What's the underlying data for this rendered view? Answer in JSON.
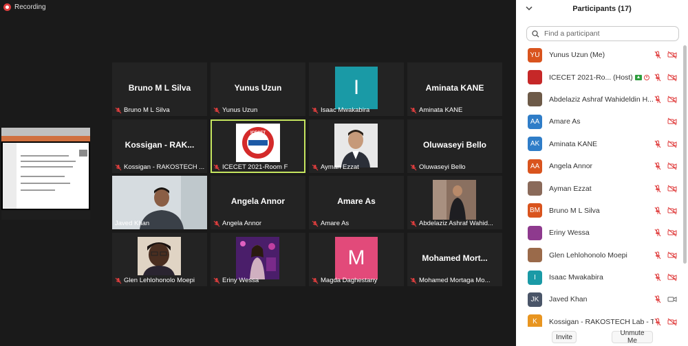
{
  "recording": {
    "label": "Recording"
  },
  "tiles": [
    {
      "id": "t1",
      "big": "Bruno M L Silva",
      "label": "Bruno M L Silva"
    },
    {
      "id": "t2",
      "big": "Yunus Uzun",
      "label": "Yunus Uzun"
    },
    {
      "id": "t3",
      "letter": "I",
      "label": "Isaac Mwakabira"
    },
    {
      "id": "t4",
      "big": "Aminata KANE",
      "label": "Aminata KANE"
    },
    {
      "id": "t5",
      "big": "Kossigan  - RAK...",
      "label": "Kossigan - RAKOSTECH ..."
    },
    {
      "id": "t6",
      "logo": "ICECET",
      "label": "ICECET 2021-Room F"
    },
    {
      "id": "t7",
      "label": "Ayman Ezzat"
    },
    {
      "id": "t8",
      "big": "Oluwaseyi Bello",
      "label": "Oluwaseyi Bello"
    },
    {
      "id": "t9",
      "label": "Javed Khan"
    },
    {
      "id": "t10",
      "big": "Angela Annor",
      "label": "Angela Annor"
    },
    {
      "id": "t11",
      "big": "Amare As",
      "label": "Amare As"
    },
    {
      "id": "t12",
      "label": "Abdelaziz Ashraf Wahid..."
    },
    {
      "id": "t13",
      "label": "Glen Lehlohonolo Moepi"
    },
    {
      "id": "t14",
      "label": "Eriny Wessa"
    },
    {
      "id": "t15",
      "letter": "M",
      "label": "Magda Daghestany"
    },
    {
      "id": "t16",
      "big": "Mohamed  Mort...",
      "label": "Mohamed Mortaga Mo..."
    }
  ],
  "panel": {
    "title": "Participants (17)",
    "search_placeholder": "Find a participant",
    "participants": [
      {
        "initials": "YU",
        "name": "Yunus Uzun (Me)",
        "color": "#d9541e",
        "cam": "off"
      },
      {
        "initials": "",
        "name": "ICECET 2021-Ro... (Host)",
        "color": "#c62828",
        "cam": "off",
        "host": true,
        "recording": true
      },
      {
        "initials": "",
        "name": "Abdelaziz Ashraf Wahideldin H...",
        "color": "#6d5a48",
        "cam": "off"
      },
      {
        "initials": "AA",
        "name": "Amare As",
        "color": "#2f7dc8",
        "cam": "off",
        "nomic": true
      },
      {
        "initials": "AK",
        "name": "Aminata KANE",
        "color": "#2f7dc8",
        "cam": "off"
      },
      {
        "initials": "AA",
        "name": "Angela Annor",
        "color": "#d9541e",
        "cam": "off"
      },
      {
        "initials": "",
        "name": "Ayman Ezzat",
        "color": "#8a6a5a",
        "cam": "off"
      },
      {
        "initials": "BM",
        "name": "Bruno M L Silva",
        "color": "#d9541e",
        "cam": "off"
      },
      {
        "initials": "",
        "name": "Eriny Wessa",
        "color": "#8e3a8e",
        "cam": "off"
      },
      {
        "initials": "",
        "name": "Glen Lehlohonolo Moepi",
        "color": "#9a6a4a",
        "cam": "off"
      },
      {
        "initials": "I",
        "name": "Isaac Mwakabira",
        "color": "#1a9aa6",
        "cam": "off"
      },
      {
        "initials": "JK",
        "name": "Javed Khan",
        "color": "#4a5568",
        "cam": "on"
      },
      {
        "initials": "K",
        "name": "Kossigan - RAKOSTECH Lab - T...",
        "color": "#e89520",
        "cam": "off"
      }
    ],
    "invite_label": "Invite",
    "unmute_label": "Unmute Me"
  },
  "colors": {
    "active_border": "#c6e65f",
    "teal": "#1a9aa6",
    "pink": "#e24a7a",
    "mic_red": "#e03e3e"
  }
}
